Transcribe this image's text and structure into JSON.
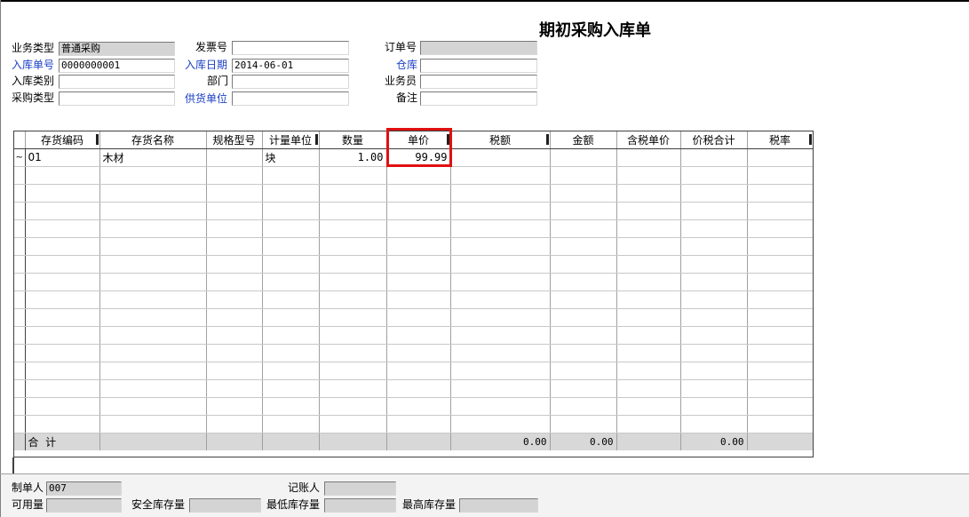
{
  "title": "期初采购入库单",
  "header": {
    "business_type": {
      "label": "业务类型",
      "value": "普通采购"
    },
    "invoice_no": {
      "label": "发票号",
      "value": ""
    },
    "order_no": {
      "label": "订单号",
      "value": ""
    },
    "receipt_no": {
      "label": "入库单号",
      "value": "0000000001"
    },
    "receipt_date": {
      "label": "入库日期",
      "value": "2014-06-01"
    },
    "warehouse": {
      "label": "仓库",
      "value": ""
    },
    "receipt_category": {
      "label": "入库类别",
      "value": ""
    },
    "department": {
      "label": "部门",
      "value": ""
    },
    "salesperson": {
      "label": "业务员",
      "value": ""
    },
    "purchase_type": {
      "label": "采购类型",
      "value": ""
    },
    "supplier": {
      "label": "供货单位",
      "value": ""
    },
    "remark": {
      "label": "备注",
      "value": ""
    }
  },
  "grid": {
    "columns": [
      "存货编码",
      "存货名称",
      "规格型号",
      "计量单位",
      "数量",
      "单价",
      "税额",
      "金额",
      "含税单价",
      "价税合计",
      "税率"
    ],
    "rows": [
      {
        "sel": "~",
        "code": "01",
        "name": "木材",
        "spec": "",
        "unit": "块",
        "qty": "1.00",
        "price": "99.99",
        "tax": "",
        "amount": "",
        "tax_price": "",
        "total": "",
        "rate": ""
      }
    ],
    "total_label": "合  计",
    "totals": {
      "tax": "0.00",
      "amount": "0.00",
      "total": "0.00"
    }
  },
  "footer": {
    "maker": {
      "label": "制单人",
      "value": "007"
    },
    "bookkeeper": {
      "label": "记账人",
      "value": ""
    },
    "available": {
      "label": "可用量",
      "value": ""
    },
    "safety_stock": {
      "label": "安全库存量",
      "value": ""
    },
    "min_stock": {
      "label": "最低库存量",
      "value": ""
    },
    "max_stock": {
      "label": "最高库存量",
      "value": ""
    }
  },
  "colors": {
    "highlight": "#e01010",
    "link_label": "#1a3fc4",
    "readonly": "#d4d4d4"
  }
}
